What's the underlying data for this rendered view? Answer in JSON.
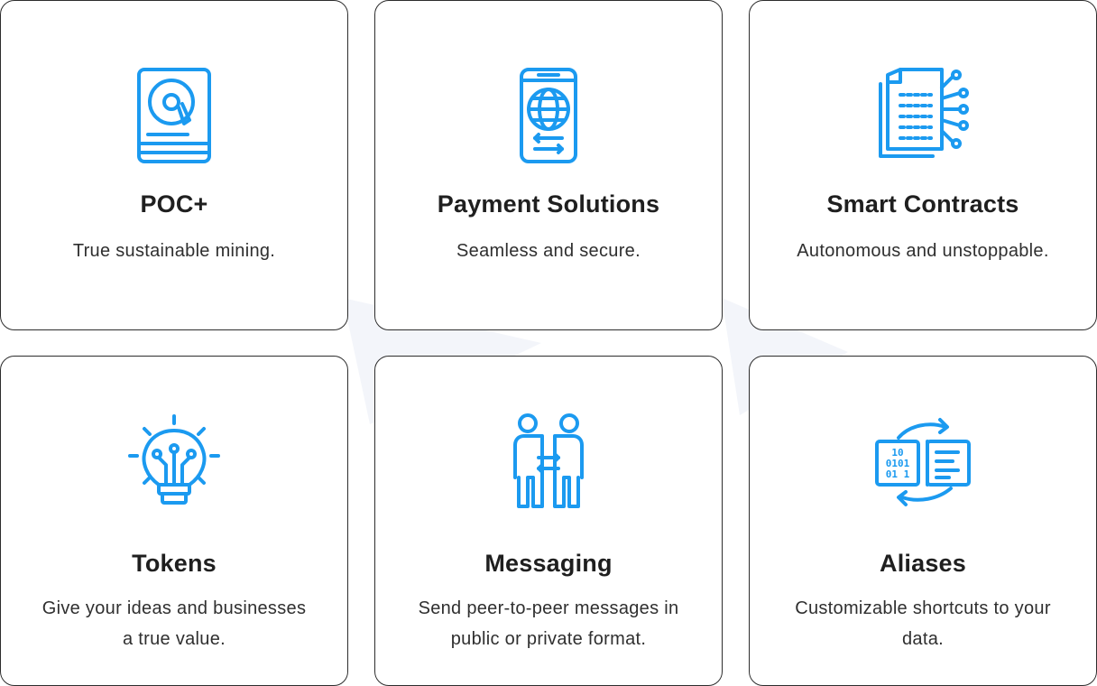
{
  "colors": {
    "accent": "#1b9af0",
    "border": "#2d2d2d",
    "title": "#1f1f1f",
    "text": "#2f2f2f"
  },
  "features": [
    {
      "icon": "hard-drive-icon",
      "title": "POC+",
      "description": "True sustainable mining."
    },
    {
      "icon": "mobile-globe-icon",
      "title": "Payment Solutions",
      "description": "Seamless and secure."
    },
    {
      "icon": "document-circuit-icon",
      "title": "Smart Contracts",
      "description": "Autonomous and unstoppable."
    },
    {
      "icon": "lightbulb-circuit-icon",
      "title": "Tokens",
      "description": "Give your ideas and businesses a true value."
    },
    {
      "icon": "people-exchange-icon",
      "title": "Messaging",
      "description": "Send peer-to-peer messages in public or private format."
    },
    {
      "icon": "data-sync-icon",
      "title": "Aliases",
      "description": "Customizable shortcuts to your data."
    }
  ]
}
